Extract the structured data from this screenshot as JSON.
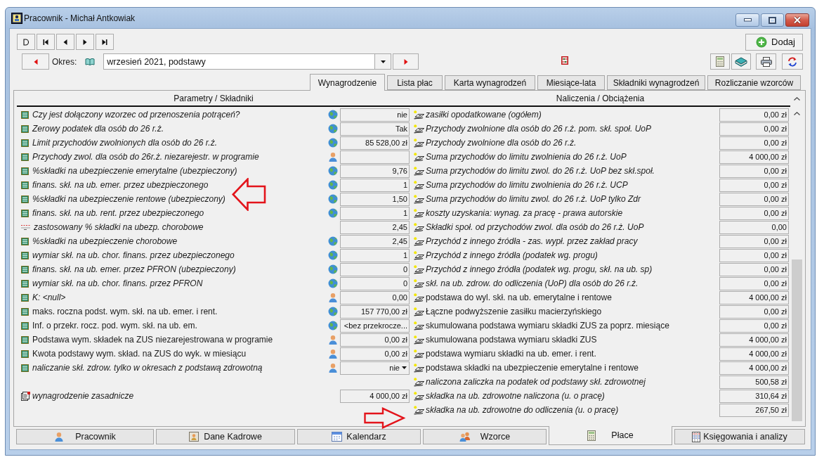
{
  "window": {
    "title": "Pracownik - Michał Antkowiak"
  },
  "toolbar": {
    "add_button": "Dodaj"
  },
  "period": {
    "label": "Okres:",
    "value": "wrzesień 2021, podstawy"
  },
  "tabs": [
    {
      "label": "Wynagrodzenie",
      "selected": true
    },
    {
      "label": "Lista płac",
      "selected": false
    },
    {
      "label": "Karta wynagrodzeń",
      "selected": false
    },
    {
      "label": "Miesiące-lata",
      "selected": false
    },
    {
      "label": "Składniki wynagrodzeń",
      "selected": false
    },
    {
      "label": "Rozliczanie wzorców",
      "selected": false
    }
  ],
  "parameters": {
    "heading": "Parametry / Składniki",
    "rows": [
      {
        "kind": "global",
        "label": "Czy jest dołączony wzorzec od przenoszenia potrąceń?",
        "inherited": true,
        "value": "nie"
      },
      {
        "kind": "global",
        "label": "Zerowy podatek dla osób do 26 r.ż.",
        "inherited": true,
        "value": "Tak"
      },
      {
        "kind": "global",
        "label": "Limit przychodów zwolnionych dla osób do 26 r.ż.",
        "inherited": true,
        "value": "85 528,00 zł"
      },
      {
        "kind": "personal",
        "label": "Przychody zwol. dla osób do 26r.ż. niezarejestr. w programie",
        "inherited": true
      },
      {
        "kind": "global",
        "label": "%składki na ubezpieczenie emerytalne (ubezpieczony)",
        "inherited": true,
        "value": "9,76"
      },
      {
        "kind": "global",
        "label": "finans. skł. na ub. emer. przez ubezpieczonego",
        "inherited": true,
        "value": "1"
      },
      {
        "kind": "global",
        "label": "%składki na ubezpieczenie rentowe (ubezpieczony)",
        "inherited": true,
        "value": "1,50"
      },
      {
        "kind": "global",
        "label": "finans. skł. na ub. rent. przez ubezpieczonego",
        "inherited": true,
        "value": "1"
      },
      {
        "kind": "calculated",
        "label": "zastosowany % składki na ubezp. chorobowe",
        "inherited": true,
        "value": "2,45"
      },
      {
        "kind": "global",
        "label": "%składki na ubezpieczenie chorobowe",
        "inherited": true,
        "value": "2,45"
      },
      {
        "kind": "global",
        "label": "wymiar skł. na ub. chor. finans. przez ubezpieczonego",
        "inherited": true,
        "value": "1"
      },
      {
        "kind": "global",
        "label": "finans. skł. na ub. emer. przez PFRON (ubezpieczony)",
        "inherited": true,
        "value": "0"
      },
      {
        "kind": "global",
        "label": "wymiar skł. na ub. chor. finans. przez PFRON",
        "inherited": true,
        "value": "0"
      },
      {
        "kind": "personal",
        "label": "K: <null>",
        "inherited": true,
        "value": "0,00"
      },
      {
        "kind": "global",
        "label": "maks. roczna podst. wym. skł. na ub. emer. i rent.",
        "inherited": false,
        "value": "157 770,00 zł"
      },
      {
        "kind": "global",
        "label": "Inf. o przekr. rocz. pod. wym. skł. na ub. em.",
        "inherited": false,
        "value": "<bez przekrocze..."
      },
      {
        "kind": "personal",
        "label": "Podstawa wym. składek na ZUS niezarejestrowana w programie",
        "inherited": false,
        "value": "0,00 zł"
      },
      {
        "kind": "personal",
        "label": "Kwota podstawy wym. skład. na ZUS do wyk. w miesiącu",
        "inherited": false,
        "value": "0,00 zł"
      },
      {
        "kind": "choice",
        "label": "naliczanie skł. zdrow. tylko w okresach z podstawą zdrowotną",
        "inherited": true,
        "value": "nie"
      }
    ],
    "components": [
      {
        "label": "wynagrodzenie zasadnicze",
        "inherited": true,
        "value": "4 000,00 zł"
      }
    ]
  },
  "charges": {
    "heading": "Naliczenia / Obciążenia",
    "rows": [
      {
        "label": "zasiłki opodatkowane (ogółem)",
        "inherited": true,
        "value": "0,00 zł"
      },
      {
        "label": "Przychody zwolnione dla osób do 26 r.ż. pom. skł. społ. UoP",
        "inherited": true,
        "value": "0,00 zł"
      },
      {
        "label": "Przychody zwolnione dla osób do 26 r.ż.",
        "inherited": true,
        "value": "0,00 zł"
      },
      {
        "label": "Suma przychodów do limitu zwolnienia do 26 r.ż. UoP",
        "inherited": true,
        "value": "4 000,00 zł"
      },
      {
        "label": "Suma przychodów do limitu zwol. do 26 r.ż. UoP bez skł.społ.",
        "inherited": true,
        "value": "0,00 zł"
      },
      {
        "label": "Suma przychodów do limitu zwolnienia do 26 r.ż. UCP",
        "inherited": true,
        "value": "0,00 zł"
      },
      {
        "label": "Suma przychodów do limitu zwol. do 26 r.ż. UoP tylko Zdr",
        "inherited": true,
        "value": "0,00 zł"
      },
      {
        "label": "koszty uzyskania: wynag. za pracę - prawa autorskie",
        "inherited": true,
        "value": "0,00 zł"
      },
      {
        "label": "Składki społ. od przychodów zwol. dla osób do 26 r.ż. UoP",
        "inherited": true,
        "value": "0,00"
      },
      {
        "label": "Przychód z innego źródła - zas. wypł. przez zakład pracy",
        "inherited": true,
        "value": "0,00 zł"
      },
      {
        "label": "Przychód z innego źródła (podatek wg. progu)",
        "inherited": true,
        "value": "0,00 zł"
      },
      {
        "label": "Przychód z innego źródła (podatek wg. progu, skł. na ub. sp)",
        "inherited": true,
        "value": "0,00 zł"
      },
      {
        "label": "skł. na ub. zdrow. do odliczenia (UoP) dla osób do 26 r.ż.",
        "inherited": true,
        "value": "0,00 zł"
      },
      {
        "label": "podstawa do wyl. skł. na ub. emerytalne i rentowe",
        "inherited": false,
        "value": "4 000,00 zł"
      },
      {
        "label": "Łączne podwyższenie zasiłku macierzyńskiego",
        "inherited": false,
        "value": "0,00 zł"
      },
      {
        "label": "skumulowana podstawa wymiaru składki ZUS za poprz. miesiące",
        "inherited": false,
        "value": "0,00 zł"
      },
      {
        "label": "skumulowana podstawa wymiaru składki ZUS",
        "inherited": false,
        "value": "4 000,00 zł"
      },
      {
        "label": "podstawa wymiaru składki na ub. emer. i rent.",
        "inherited": false,
        "value": "4 000,00 zł"
      },
      {
        "label": "podstawa składki na ubezpieczenie emerytalne i rentowe",
        "inherited": false,
        "value": "4 000,00 zł"
      },
      {
        "label": "naliczona zaliczka na podatek od podstawy skł. zdrowotnej",
        "inherited": true,
        "value": "500,58 zł"
      },
      {
        "label": "składka na ub. zdrowotne naliczona (u. o pracę)",
        "inherited": true,
        "value": "310,64 zł"
      },
      {
        "label": "składka na ub. zdrowotne do odliczenia (u. o pracę)",
        "inherited": true,
        "value": "267,50 zł"
      }
    ]
  },
  "bottom_tabs": [
    {
      "label": "Pracownik",
      "selected": false
    },
    {
      "label": "Dane Kadrowe",
      "selected": false
    },
    {
      "label": "Kalendarz",
      "selected": false
    },
    {
      "label": "Wzorce",
      "selected": false
    },
    {
      "label": "Płace",
      "selected": true
    },
    {
      "label": "Księgowania i analizy",
      "selected": false
    }
  ]
}
